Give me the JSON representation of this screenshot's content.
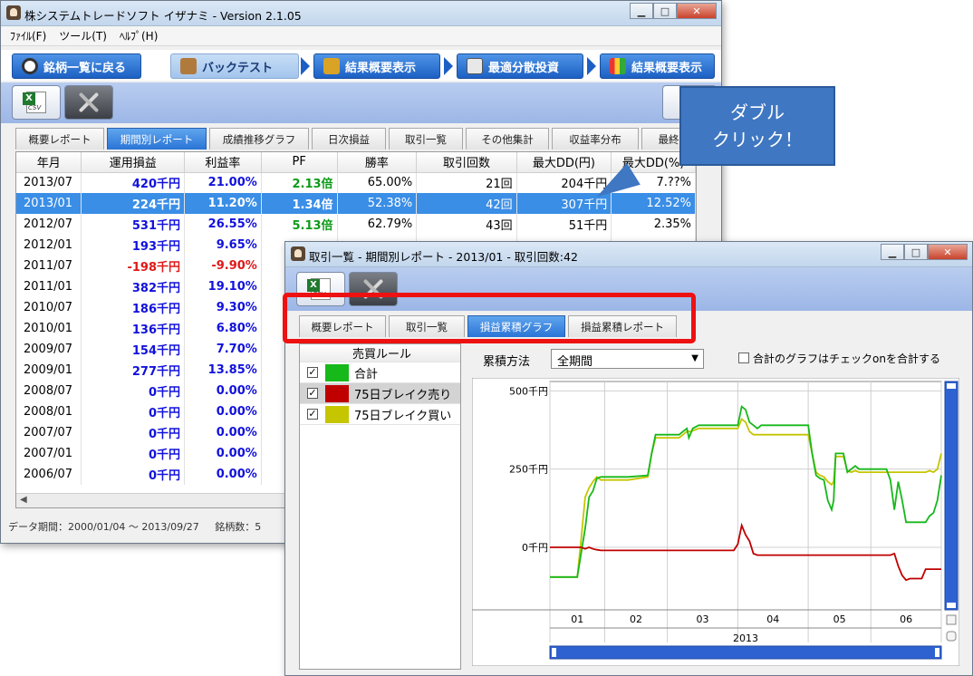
{
  "main_window": {
    "title": "株システムトレードソフト イザナミ - Version 2.1.05",
    "menu": [
      "ﾌｧｲﾙ(F)",
      "ツール(T)",
      "ﾍﾙﾌﾟ(H)"
    ],
    "nav": [
      "銘柄一覧に戻る",
      "バックテスト",
      "結果概要表示",
      "最適分散投資",
      "結果概要表示"
    ],
    "tabs": [
      "概要レポート",
      "期間別レポート",
      "成績推移グラフ",
      "日次損益",
      "取引一覧",
      "その他集計",
      "収益率分布",
      "最終"
    ],
    "active_tab": 1,
    "columns": [
      "年月",
      "運用損益",
      "利益率",
      "PF",
      "勝率",
      "取引回数",
      "最大DD(円)",
      "最大DD(%)"
    ],
    "rows": [
      [
        "2013/07",
        "420千円",
        "21.00%",
        "2.13倍",
        "65.00%",
        "21回",
        "204千円",
        "7.??%"
      ],
      [
        "2013/01",
        "224千円",
        "11.20%",
        "1.34倍",
        "52.38%",
        "42回",
        "307千円",
        "12.52%"
      ],
      [
        "2012/07",
        "531千円",
        "26.55%",
        "5.13倍",
        "62.79%",
        "43回",
        "51千円",
        "2.35%"
      ],
      [
        "2012/01",
        "193千円",
        "9.65%",
        "",
        "",
        "",
        "",
        ""
      ],
      [
        "2011/07",
        "-198千円",
        "-9.90%",
        "",
        "",
        "",
        "",
        ""
      ],
      [
        "2011/01",
        "382千円",
        "19.10%",
        "",
        "",
        "",
        "",
        ""
      ],
      [
        "2010/07",
        "186千円",
        "9.30%",
        "",
        "",
        "",
        "",
        ""
      ],
      [
        "2010/01",
        "136千円",
        "6.80%",
        "",
        "",
        "",
        "",
        ""
      ],
      [
        "2009/07",
        "154千円",
        "7.70%",
        "",
        "",
        "",
        "",
        ""
      ],
      [
        "2009/01",
        "277千円",
        "13.85%",
        "",
        "",
        "",
        "",
        ""
      ],
      [
        "2008/07",
        "0千円",
        "0.00%",
        "",
        "",
        "",
        "",
        ""
      ],
      [
        "2008/01",
        "0千円",
        "0.00%",
        "",
        "",
        "",
        "",
        ""
      ],
      [
        "2007/07",
        "0千円",
        "0.00%",
        "",
        "",
        "",
        "",
        ""
      ],
      [
        "2007/01",
        "0千円",
        "0.00%",
        "",
        "",
        "",
        "",
        ""
      ],
      [
        "2006/07",
        "0千円",
        "0.00%",
        "",
        "",
        "",
        "",
        ""
      ]
    ],
    "selected_row": 1,
    "status": "データ期間：2000/01/04 〜 2013/09/27",
    "status2": "銘柄数：5"
  },
  "callout": {
    "line1": "ダブル",
    "line2": "クリック！"
  },
  "sub_window": {
    "title": "取引一覧 - 期間別レポート - 2013/01 - 取引回数:42",
    "tabs": [
      "概要レポート",
      "取引一覧",
      "損益累積グラフ",
      "損益累積レポート"
    ],
    "active_tab": 2,
    "legend_header": "売買ルール",
    "legend_items": [
      {
        "label": "合計",
        "color": "#17b81a",
        "checked": "✓"
      },
      {
        "label": "75日ブレイク売り",
        "color": "#c00000",
        "checked": "✓"
      },
      {
        "label": "75日ブレイク買い",
        "color": "#c5c500",
        "checked": "✓"
      }
    ],
    "accum_label": "累積方法",
    "accum_value": "全期間",
    "sum_checkbox_label": "合計のグラフはチェックonを合計する"
  },
  "chart_data": {
    "type": "line",
    "y_tick_labels": [
      "500千円",
      "250千円",
      "0千円"
    ],
    "y_ticks": [
      500,
      250,
      0
    ],
    "ylim": [
      -200,
      530
    ],
    "xlim": [
      0,
      100
    ],
    "x_tick_labels": [
      "01",
      "02",
      "03",
      "04",
      "05",
      "06"
    ],
    "x_ticks": [
      7,
      22,
      39,
      57,
      74,
      91
    ],
    "x_group_label": "2013",
    "series": [
      {
        "name": "合計",
        "color": "#17b81a",
        "x": [
          0,
          5,
          7,
          9,
          10,
          11,
          12,
          13,
          20,
          25,
          26,
          27,
          33,
          34,
          35,
          35.5,
          36.5,
          38,
          39,
          48,
          49,
          50,
          51,
          52,
          53,
          54,
          56,
          57,
          66,
          67,
          68,
          69,
          70,
          71,
          72,
          72.5,
          73,
          75,
          76,
          77,
          78,
          79,
          86,
          87,
          88,
          89,
          90,
          91,
          96,
          97,
          98,
          99,
          100
        ],
        "y": [
          -95,
          -95,
          -95,
          60,
          160,
          180,
          220,
          225,
          225,
          230,
          300,
          360,
          360,
          370,
          380,
          350,
          380,
          390,
          390,
          390,
          450,
          440,
          400,
          390,
          380,
          390,
          390,
          390,
          390,
          300,
          230,
          220,
          215,
          150,
          120,
          150,
          300,
          300,
          240,
          250,
          260,
          250,
          250,
          215,
          120,
          210,
          150,
          80,
          80,
          100,
          110,
          150,
          230
        ]
      },
      {
        "name": "75日ブレイク売り",
        "color": "#c00000",
        "x": [
          0,
          8,
          9,
          10,
          11,
          12,
          13,
          14,
          47,
          48,
          48.5,
          49,
          50,
          51,
          52,
          53,
          54,
          87,
          88,
          89,
          90,
          91,
          92,
          95,
          96,
          97,
          100
        ],
        "y": [
          0,
          0,
          -5,
          0,
          -5,
          -8,
          -10,
          -10,
          -10,
          10,
          40,
          70,
          40,
          20,
          -20,
          -25,
          -25,
          -25,
          -20,
          -60,
          -90,
          -105,
          -100,
          -100,
          -70,
          -70,
          -70
        ]
      },
      {
        "name": "75日ブレイク買い",
        "color": "#c5c500",
        "x": [
          0,
          7,
          8,
          9,
          10,
          11,
          12,
          13,
          20,
          25,
          26,
          27,
          33,
          34,
          35,
          36,
          38,
          39,
          48,
          49,
          50,
          51,
          52,
          53,
          54,
          57,
          66,
          67,
          68,
          69,
          70,
          71,
          72,
          72.5,
          73,
          75,
          76,
          77,
          78,
          79,
          96,
          97,
          98,
          99,
          100
        ],
        "y": [
          -95,
          -95,
          30,
          160,
          190,
          210,
          225,
          215,
          215,
          225,
          300,
          350,
          350,
          360,
          370,
          370,
          380,
          380,
          380,
          410,
          400,
          370,
          360,
          360,
          360,
          360,
          360,
          300,
          240,
          230,
          225,
          210,
          200,
          210,
          290,
          290,
          245,
          240,
          245,
          240,
          240,
          245,
          240,
          250,
          300
        ]
      }
    ]
  }
}
